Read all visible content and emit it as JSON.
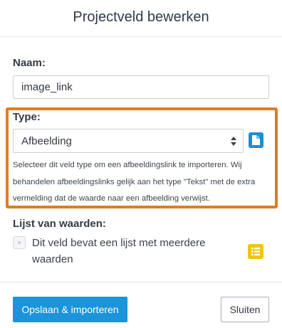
{
  "dialog": {
    "title": "Projectveld bewerken"
  },
  "name_field": {
    "label": "Naam:",
    "value": "image_link"
  },
  "type_field": {
    "label": "Type:",
    "selected": "Afbeelding",
    "help": "Selecteer dit veld type om een afbeeldingslink te importeren. Wij behandelen afbeeldingslinks gelijk aan het type \"Tekst\" met de extra vermelding dat de waarde naar een afbeelding verwijst.",
    "doc_icon": "document-icon"
  },
  "values_list": {
    "label": "Lijst van waarden:",
    "checkbox_label": "Dit veld bevat een lijst met meerdere waarden",
    "checked": false,
    "list_icon": "list-icon"
  },
  "footer": {
    "save_label": "Opslaan & importeren",
    "close_label": "Sluiten"
  },
  "colors": {
    "highlight_border": "#e07c22",
    "primary": "#1b94db",
    "list_icon_bg": "#f1c40f"
  }
}
